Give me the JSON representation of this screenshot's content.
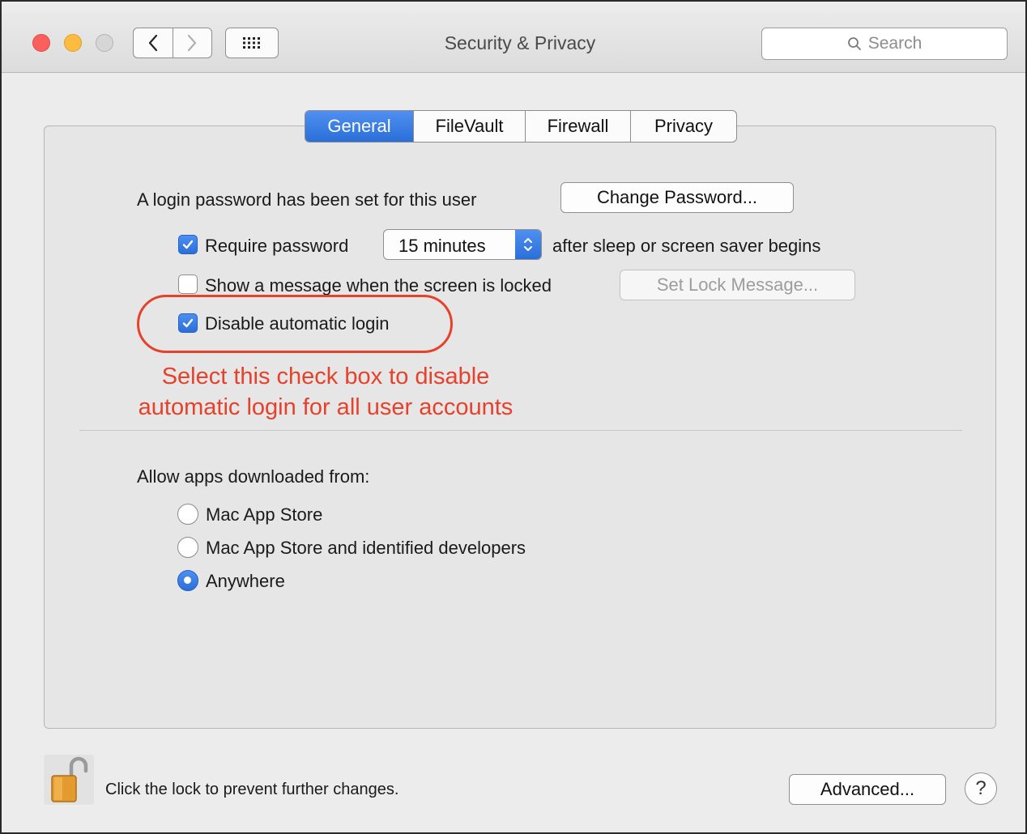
{
  "window": {
    "title": "Security & Privacy",
    "search_placeholder": "Search"
  },
  "tabs": [
    {
      "label": "General",
      "active": true
    },
    {
      "label": "FileVault",
      "active": false
    },
    {
      "label": "Firewall",
      "active": false
    },
    {
      "label": "Privacy",
      "active": false
    }
  ],
  "general": {
    "login_password_text": "A login password has been set for this user",
    "change_password_label": "Change Password...",
    "require_password": {
      "checked": true,
      "label": "Require password",
      "interval": "15 minutes",
      "suffix": "after sleep or screen saver begins"
    },
    "show_message": {
      "checked": false,
      "label": "Show a message when the screen is locked",
      "button": "Set Lock Message..."
    },
    "disable_auto_login": {
      "checked": true,
      "label": "Disable automatic login"
    }
  },
  "annotation": {
    "line1": "Select this check box to disable",
    "line2": "automatic login for all user accounts",
    "color": "#e5412b"
  },
  "apps": {
    "heading": "Allow apps downloaded from:",
    "options": [
      {
        "label": "Mac App Store",
        "selected": false
      },
      {
        "label": "Mac App Store and identified developers",
        "selected": false
      },
      {
        "label": "Anywhere",
        "selected": true
      }
    ]
  },
  "footer": {
    "lock_text": "Click the lock to prevent further changes.",
    "advanced_label": "Advanced...",
    "help_label": "?"
  },
  "colors": {
    "accent": "#2a6fd9"
  }
}
